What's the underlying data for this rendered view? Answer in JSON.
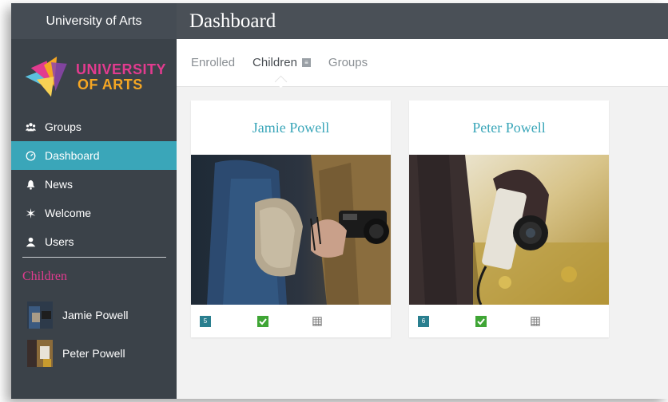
{
  "sidebar": {
    "app_name": "University of Arts",
    "logo": {
      "line1": "UNIVERSITY",
      "line2": "OF ARTS"
    },
    "nav": [
      {
        "label": "Groups",
        "icon": "groups-icon"
      },
      {
        "label": "Dashboard",
        "icon": "dashboard-icon",
        "active": true
      },
      {
        "label": "News",
        "icon": "bell-icon"
      },
      {
        "label": "Welcome",
        "icon": "sparkle-icon"
      },
      {
        "label": "Users",
        "icon": "user-icon"
      }
    ],
    "children_title": "Children",
    "children": [
      {
        "name": "Jamie Powell"
      },
      {
        "name": "Peter Powell"
      }
    ]
  },
  "header": {
    "title": "Dashboard"
  },
  "tabs": [
    {
      "label": "Enrolled"
    },
    {
      "label": "Children",
      "active": true,
      "badge": "≡"
    },
    {
      "label": "Groups"
    }
  ],
  "cards": [
    {
      "name": "Jamie Powell",
      "count": "5"
    },
    {
      "name": "Peter Powell",
      "count": "6"
    }
  ],
  "colors": {
    "accent": "#3aa6b9",
    "pink": "#e23b8f",
    "sidebar": "#3b4249",
    "check": "#3fa535"
  }
}
